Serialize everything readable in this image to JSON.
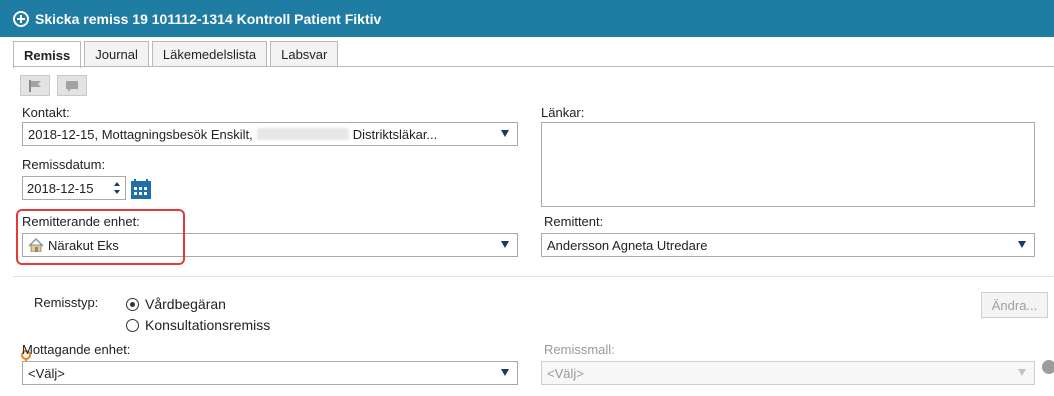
{
  "window": {
    "title": "Skicka remiss 19 101112-1314 Kontroll Patient Fiktiv"
  },
  "tabs": [
    {
      "label": "Remiss",
      "active": true
    },
    {
      "label": "Journal",
      "active": false
    },
    {
      "label": "Läkemedelslista",
      "active": false
    },
    {
      "label": "Labsvar",
      "active": false
    }
  ],
  "toolbar": {
    "flag_icon": "flag-icon",
    "comment_icon": "comment-icon"
  },
  "kontakt": {
    "label": "Kontakt:",
    "value_prefix": "2018-12-15, Mottagningsbesök Enskilt,",
    "value_suffix": "Distriktsläkar..."
  },
  "remissdatum": {
    "label": "Remissdatum:",
    "value": "2018-12-15"
  },
  "lankar": {
    "label": "Länkar:"
  },
  "remitterande_enhet": {
    "label": "Remitterande enhet:",
    "value": "Närakut Eks",
    "icon": "home-icon"
  },
  "remittent": {
    "label": "Remittent:",
    "value": "Andersson Agneta Utredare"
  },
  "remisstyp": {
    "label": "Remisstyp:",
    "options": [
      {
        "label": "Vårdbegäran",
        "checked": true
      },
      {
        "label": "Konsultationsremiss",
        "checked": false
      }
    ]
  },
  "andra_button": {
    "label": "Ändra..."
  },
  "mottagande_enhet": {
    "label": "Mottagande enhet:",
    "value": "<Välj>"
  },
  "remissmall": {
    "label": "Remissmall:",
    "value": "<Välj>"
  },
  "colors": {
    "titlebar": "#1f7ca3",
    "highlight": "#e33b3b",
    "required_marker": "#f08020"
  }
}
